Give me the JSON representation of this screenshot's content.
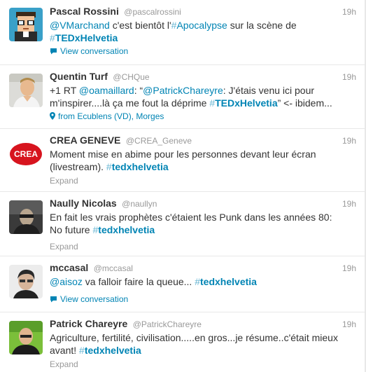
{
  "tweets": [
    {
      "fullname": "Pascal Rossini",
      "username": "@pascalrossini",
      "time": "19h",
      "mention1": "@VMarchand",
      "text1": " c'est bientôt l'",
      "hashtag1": "Apocalypse",
      "text2": " sur la scène de",
      "hashtag2": "TEDxHelvetia",
      "footer": "View conversation",
      "footer_icon": "speech-bubble-icon"
    },
    {
      "fullname": "Quentin Turf",
      "username": "@CHQue",
      "time": "19h",
      "text1": "+1 RT ",
      "mention1": "@oamaillard",
      "text2": ": “",
      "mention2": "@PatrickChareyre",
      "text3": ": J'étais venu ici pour",
      "text4": "m'inspirer....là ça me fout la déprime ",
      "hashtag1": "TEDxHelvetia",
      "text5": "” <- ibidem...",
      "footer": "from Ecublens (VD), Morges",
      "footer_icon": "map-pin-icon"
    },
    {
      "fullname": "CREA GENEVE",
      "username": "@CREA_Geneve",
      "time": "19h",
      "text1": "Moment mise en abime pour les personnes devant leur écran",
      "text2": "(livestream). ",
      "hashtag1": "tedxhelvetia",
      "footer": "Expand",
      "avatar_text": "CREA"
    },
    {
      "fullname": "Naully Nicolas",
      "username": "@naullyn",
      "time": "19h",
      "text1": "En fait les vrais prophètes c'étaient les Punk dans les années 80:",
      "text2": "No future ",
      "hashtag1": "tedxhelvetia",
      "footer": "Expand"
    },
    {
      "fullname": "mccasal",
      "username": "@mccasal",
      "time": "19h",
      "mention1": "@aisoz",
      "text1": " va falloir faire la queue... ",
      "hashtag1": "tedxhelvetia",
      "footer": "View conversation",
      "footer_icon": "speech-bubble-icon"
    },
    {
      "fullname": "Patrick Chareyre",
      "username": "@PatrickChareyre",
      "time": "19h",
      "text1": "Agriculture, fertilité, civilisation.....en gros...je résume..c'était mieux",
      "text2": "avant! ",
      "hashtag1": "tedxhelvetia",
      "footer": "Expand"
    }
  ],
  "hash_symbol": "#",
  "colors": {
    "link": "#0084b4",
    "muted": "#999999",
    "text": "#333333",
    "crea_red": "#d7141e"
  }
}
